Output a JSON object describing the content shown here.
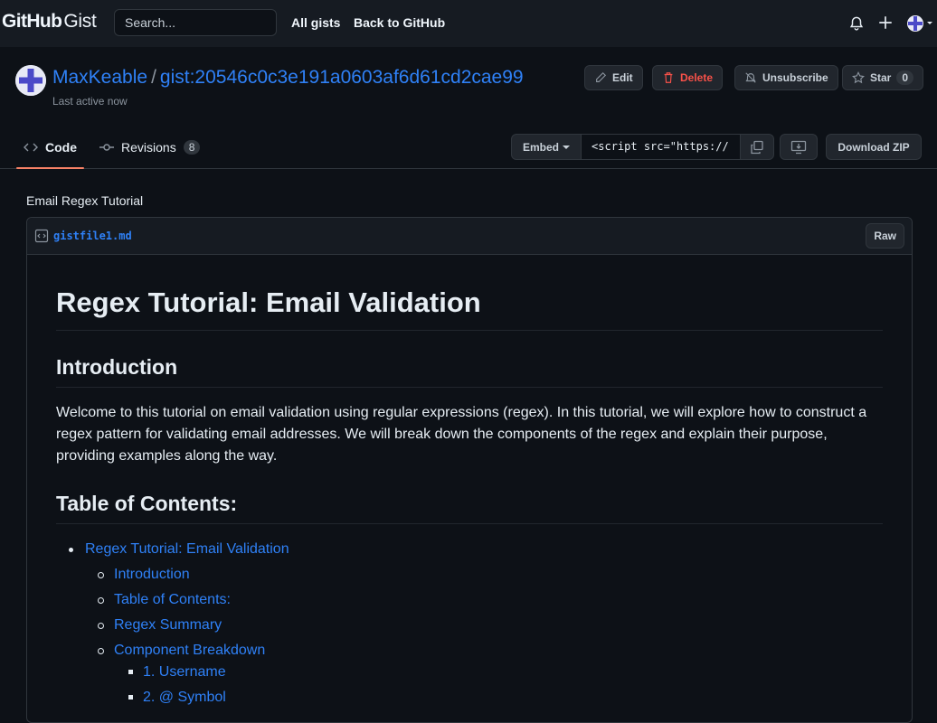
{
  "header": {
    "logo_bold": "GitHub",
    "logo_light": "Gist",
    "search_placeholder": "Search...",
    "nav": [
      "All gists",
      "Back to GitHub"
    ]
  },
  "gist": {
    "owner": "MaxKeable",
    "separator": "/",
    "id": "gist:20546c0c3e191a0603af6d61cd2cae99",
    "last_active": "Last active now",
    "actions": {
      "edit": "Edit",
      "delete": "Delete",
      "unsubscribe": "Unsubscribe",
      "star": "Star",
      "star_count": "0"
    }
  },
  "tabs": {
    "code": "Code",
    "revisions": "Revisions",
    "revisions_count": "8"
  },
  "embed": {
    "label": "Embed",
    "value": "<script src=\"https://"
  },
  "download_zip": "Download ZIP",
  "file": {
    "description": "Email Regex Tutorial",
    "name": "gistfile1.md",
    "raw": "Raw"
  },
  "markdown": {
    "h1": "Regex Tutorial: Email Validation",
    "h2_intro": "Introduction",
    "intro_paragraph": "Welcome to this tutorial on email validation using regular expressions (regex). In this tutorial, we will explore how to construct a regex pattern for validating email addresses. We will break down the components of the regex and explain their purpose, providing examples along the way.",
    "h2_toc": "Table of Contents:",
    "toc_top": "Regex Tutorial: Email Validation",
    "toc_sub": [
      "Introduction",
      "Table of Contents:",
      "Regex Summary",
      "Component Breakdown"
    ],
    "toc_subsub": [
      "1. Username",
      "2. @ Symbol"
    ]
  },
  "colors": {
    "background": "#0d1117",
    "header": "#161b22",
    "link": "#2f81f7",
    "danger": "#f85149",
    "tab_underline": "#f78166"
  }
}
